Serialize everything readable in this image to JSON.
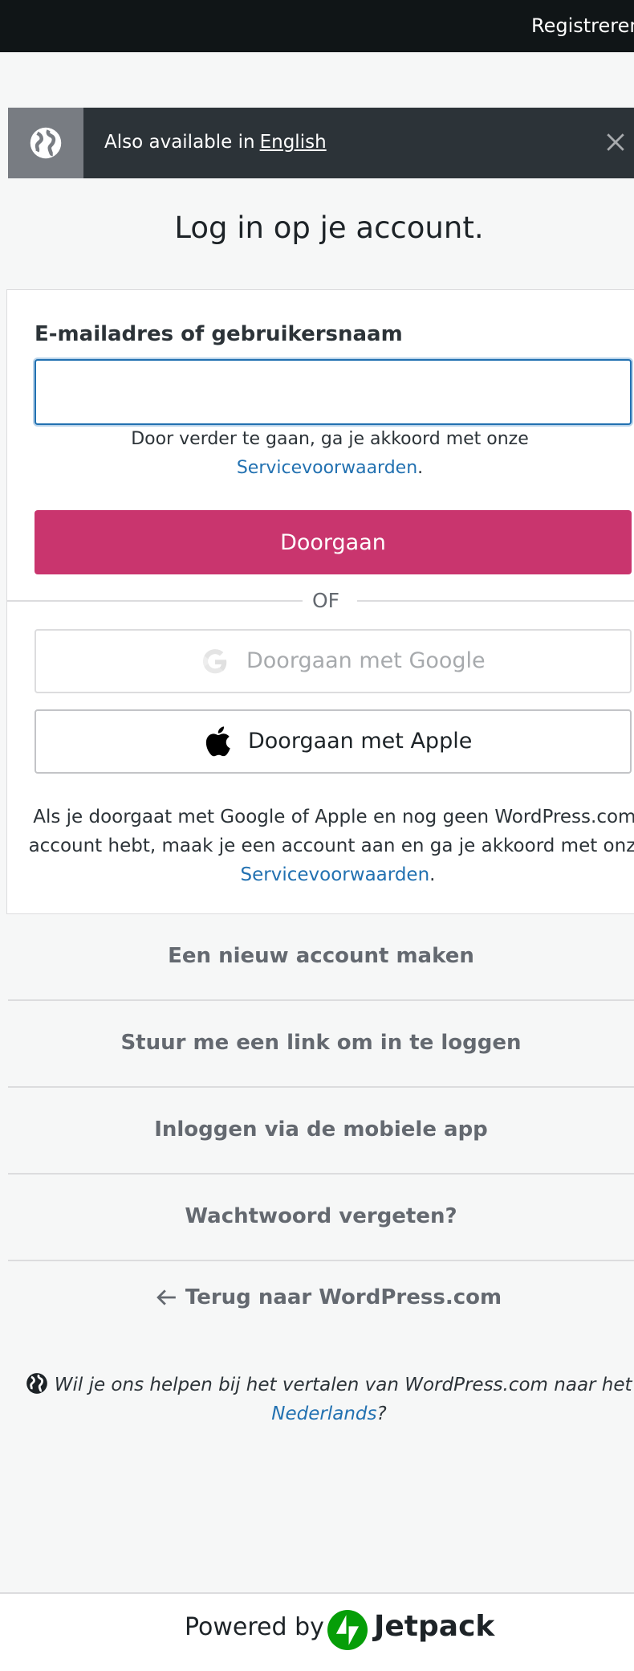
{
  "topbar": {
    "register_label": "Registreren"
  },
  "language_banner": {
    "text": "Also available in",
    "link": "English",
    "icon": "globe-icon",
    "close_icon": "close-icon"
  },
  "heading": "Log in op je account.",
  "form": {
    "email_label": "E-mailadres of gebruikersnaam",
    "email_value": "",
    "terms_prefix": "Door verder te gaan, ga je akkoord met onze",
    "terms_link": "Servicevoorwaarden",
    "terms_suffix": ".",
    "continue_label": "Doorgaan",
    "divider": "OF",
    "google_label": "Doorgaan met Google",
    "apple_label": "Doorgaan met Apple",
    "social_note_prefix": "Als je doorgaat met Google of Apple en nog geen WordPress.com-account hebt, maak je een account aan en ga je akkoord met onze",
    "social_note_link": "Servicevoorwaarden",
    "social_note_suffix": "."
  },
  "links": [
    "Een nieuw account maken",
    "Stuur me een link om in te loggen",
    "Inloggen via de mobiele app",
    "Wachtwoord vergeten?"
  ],
  "back_link": "Terug naar WordPress.com",
  "translate": {
    "prefix": "Wil je ons helpen bij het vertalen van WordPress.com naar het",
    "link": "Nederlands",
    "suffix": "?"
  },
  "footer": {
    "powered_by": "Powered by",
    "brand": "Jetpack",
    "brand_color": "#069e08"
  },
  "colors": {
    "primary_button": "#c9356e",
    "link": "#2271b1",
    "topbar": "#101517",
    "banner": "#2c3338"
  }
}
